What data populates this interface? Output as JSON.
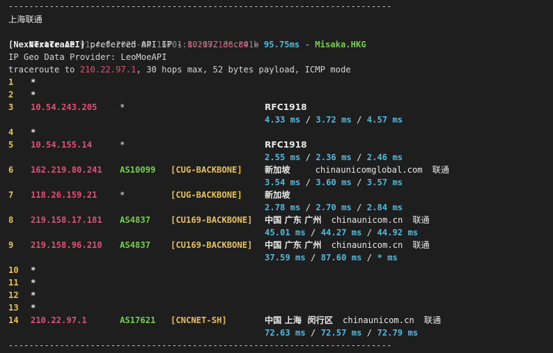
{
  "separator": "---------------------------------------------------------------------------",
  "header": {
    "location": "上海联通",
    "app_name": "NextTrace",
    "version": "v1.4.0 2025-04-16T01:10:07Z dccc41b",
    "api_label": "[NextTrace API]",
    "api_text": " preferred API IP - ",
    "api_ip": "8.219.136.89",
    "dash1": " - ",
    "api_latency": "95.75ms",
    "dash2": " - ",
    "api_node": "Misaka.HKG",
    "geo_provider": "IP Geo Data Provider: LeoMoeAPI",
    "trace_prefix": "traceroute to ",
    "trace_target": "210.22.97.1",
    "trace_suffix": ", 30 hops max, 52 bytes payload, ICMP mode"
  },
  "colors": {
    "background": "#1e1e1e",
    "ip": "#e0507a",
    "latency": "#52b9dc",
    "asn": "#74d04a",
    "tag": "#e5c15b",
    "hop_number": "#e5c15b"
  },
  "hops": [
    {
      "n": "1",
      "ip": "*",
      "as": "",
      "tag": "",
      "geo": "",
      "domain": "",
      "isp": "",
      "rtt": []
    },
    {
      "n": "2",
      "ip": "*",
      "as": "",
      "tag": "",
      "geo": "",
      "domain": "",
      "isp": "",
      "rtt": []
    },
    {
      "n": "3",
      "ip": "10.54.243.205",
      "as": "*",
      "tag": "",
      "geo": "RFC1918",
      "domain": "",
      "isp": "",
      "rtt": [
        "4.33 ms",
        "3.72 ms",
        "4.57 ms"
      ]
    },
    {
      "n": "4",
      "ip": "*",
      "as": "",
      "tag": "",
      "geo": "",
      "domain": "",
      "isp": "",
      "rtt": []
    },
    {
      "n": "5",
      "ip": "10.54.155.14",
      "as": "*",
      "tag": "",
      "geo": "RFC1918",
      "domain": "",
      "isp": "",
      "rtt": [
        "2.55 ms",
        "2.36 ms",
        "2.46 ms"
      ]
    },
    {
      "n": "6",
      "ip": "162.219.80.241",
      "as": "AS10099",
      "tag": "[CUG-BACKBONE]",
      "geo": "新加坡",
      "domain": "chinaunicomglobal.com",
      "isp": "联通",
      "rtt": [
        "3.54 ms",
        "3.60 ms",
        "3.57 ms"
      ]
    },
    {
      "n": "7",
      "ip": "118.26.159.21",
      "as": "*",
      "tag": "[CUG-BACKBONE]",
      "geo": "新加坡",
      "domain": "",
      "isp": "",
      "rtt": [
        "2.78 ms",
        "2.70 ms",
        "2.84 ms"
      ]
    },
    {
      "n": "8",
      "ip": "219.158.17.181",
      "as": "AS4837",
      "tag": "[CU169-BACKBONE]",
      "geo": "中国 广东 广州",
      "domain": "chinaunicom.cn",
      "isp": "联通",
      "rtt": [
        "45.01 ms",
        "44.27 ms",
        "44.92 ms"
      ]
    },
    {
      "n": "9",
      "ip": "219.158.96.210",
      "as": "AS4837",
      "tag": "[CU169-BACKBONE]",
      "geo": "中国 广东 广州",
      "domain": "chinaunicom.cn",
      "isp": "联通",
      "rtt": [
        "37.59 ms",
        "87.60 ms",
        "* ms"
      ]
    },
    {
      "n": "10",
      "ip": "*",
      "as": "",
      "tag": "",
      "geo": "",
      "domain": "",
      "isp": "",
      "rtt": []
    },
    {
      "n": "11",
      "ip": "*",
      "as": "",
      "tag": "",
      "geo": "",
      "domain": "",
      "isp": "",
      "rtt": []
    },
    {
      "n": "12",
      "ip": "*",
      "as": "",
      "tag": "",
      "geo": "",
      "domain": "",
      "isp": "",
      "rtt": []
    },
    {
      "n": "13",
      "ip": "*",
      "as": "",
      "tag": "",
      "geo": "",
      "domain": "",
      "isp": "",
      "rtt": []
    },
    {
      "n": "14",
      "ip": "210.22.97.1",
      "as": "AS17621",
      "tag": "[CNCNET-SH]",
      "geo": "中国 上海  闵行区",
      "domain": "chinaunicom.cn",
      "isp": "联通",
      "rtt": [
        "72.63 ms",
        "72.57 ms",
        "72.79 ms"
      ]
    }
  ]
}
